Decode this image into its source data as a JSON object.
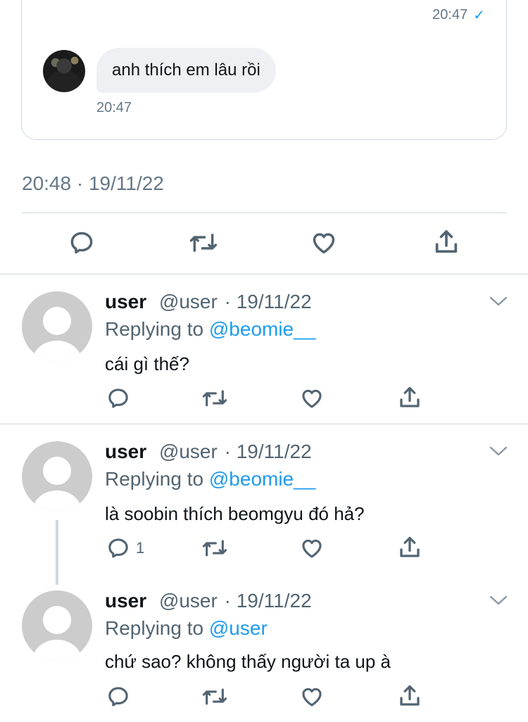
{
  "dm": {
    "sent_time": "20:47",
    "received_message": "anh thích em lâu rồi",
    "received_time": "20:47"
  },
  "tweet": {
    "timestamp": "20:48 · 19/11/22"
  },
  "icons": {
    "reply": "reply-icon",
    "retweet": "retweet-icon",
    "like": "heart-icon",
    "share": "share-icon",
    "more": "chevron-down-icon",
    "read_receipt": "check-icon"
  },
  "colors": {
    "accent": "#1d9bf0",
    "muted": "#536471",
    "border": "#cfd9de"
  },
  "replies": [
    {
      "name": "user",
      "handle": "@user",
      "date": "· 19/11/22",
      "replying_prefix": "Replying to",
      "replying_to": "@beomie__",
      "text": "cái gì thế?",
      "reply_count": ""
    },
    {
      "name": "user",
      "handle": "@user",
      "date": "· 19/11/22",
      "replying_prefix": "Replying to",
      "replying_to": "@beomie__",
      "text": "là soobin thích beomgyu đó hả?",
      "reply_count": "1"
    },
    {
      "name": "user",
      "handle": "@user",
      "date": "· 19/11/22",
      "replying_prefix": "Replying to",
      "replying_to": "@user",
      "text": "chứ sao? không thấy người ta up à",
      "reply_count": ""
    }
  ]
}
